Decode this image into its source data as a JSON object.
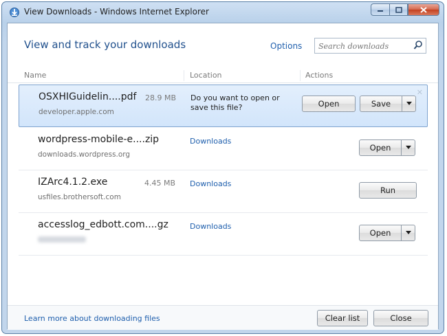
{
  "window": {
    "title": "View Downloads - Windows Internet Explorer"
  },
  "header": {
    "title": "View and track your downloads",
    "options_label": "Options",
    "search_placeholder": "Search downloads"
  },
  "columns": {
    "name": "Name",
    "location": "Location",
    "actions": "Actions"
  },
  "downloads": [
    {
      "name": "OSXHIGuidelin....pdf",
      "size": "28.9 MB",
      "source": "developer.apple.com",
      "location_prompt": "Do you want to open or save this file?",
      "primary": "Open",
      "secondary": "Save"
    },
    {
      "name": "wordpress-mobile-e....zip",
      "size": "",
      "source": "downloads.wordpress.org",
      "location": "Downloads",
      "action": "Open"
    },
    {
      "name": "IZArc4.1.2.exe",
      "size": "4.45 MB",
      "source": "usfiles.brothersoft.com",
      "location": "Downloads",
      "action": "Run"
    },
    {
      "name": "accesslog_edbott.com....gz",
      "size": "",
      "source": "",
      "location": "Downloads",
      "action": "Open"
    }
  ],
  "footer": {
    "learn_more": "Learn more about downloading files",
    "clear_list": "Clear list",
    "close": "Close"
  },
  "colors": {
    "link": "#1f5fad",
    "selected_row": "#d2e5fb",
    "title_bar": "#c2d6ec"
  }
}
